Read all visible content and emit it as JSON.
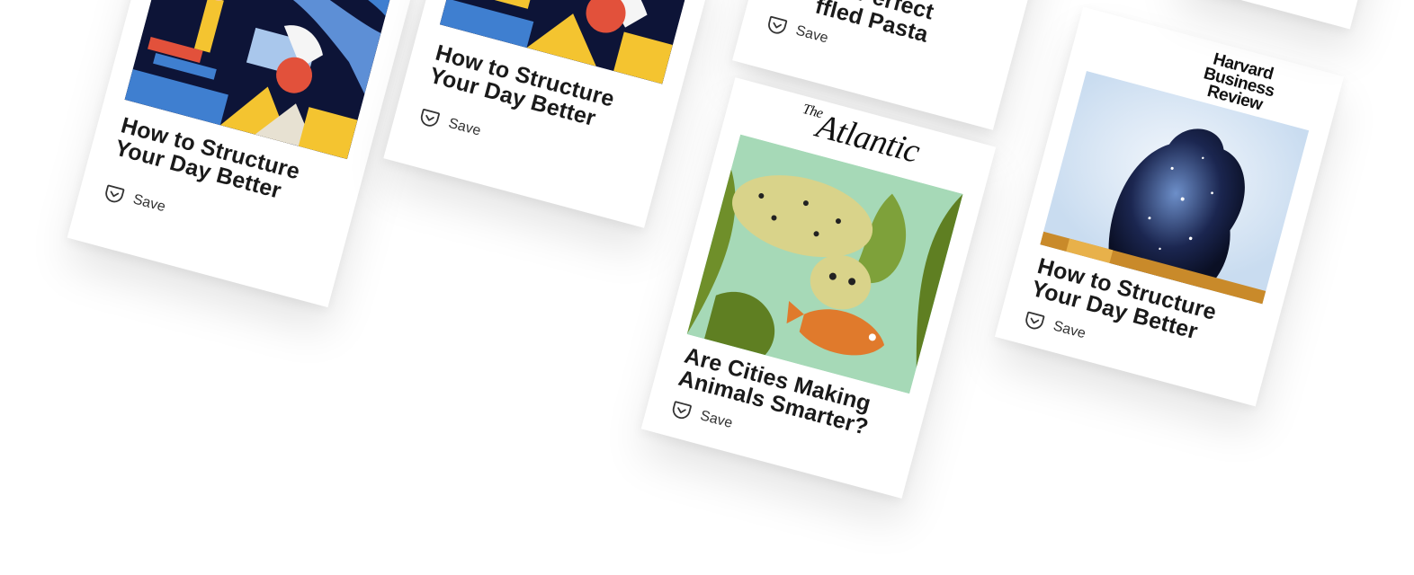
{
  "cards": {
    "c1": {
      "title": "How to Structure Your Day Better",
      "save": "Save"
    },
    "c2": {
      "title": "How to Structure Your Day Better",
      "save": "Save"
    },
    "c3": {
      "title": "…Perfect …fled Pasta",
      "title_line1": "Perfect",
      "title_line2": "ffled Pasta",
      "save": "Save"
    },
    "c4": {
      "publisher": "The Atlantic",
      "pub_the": "The",
      "pub_name": "Atlantic",
      "title": "Are Cities Making Animals Smarter?",
      "save": "Save"
    },
    "c5": {
      "publisher": "Harvard Business Review",
      "pub_l1": "Harvard",
      "pub_l2": "Business",
      "pub_l3": "Review",
      "title": "How to Structure Your Day Better",
      "save": "Save"
    }
  },
  "icons": {
    "save": "pocket-save-icon"
  },
  "colors": {
    "navy": "#0d1437",
    "blue": "#3f7fd0",
    "yellow": "#f4c430",
    "red": "#e2513b",
    "green": "#6f8f2a",
    "mint": "#9dd3b0",
    "orange": "#e07a2c"
  }
}
